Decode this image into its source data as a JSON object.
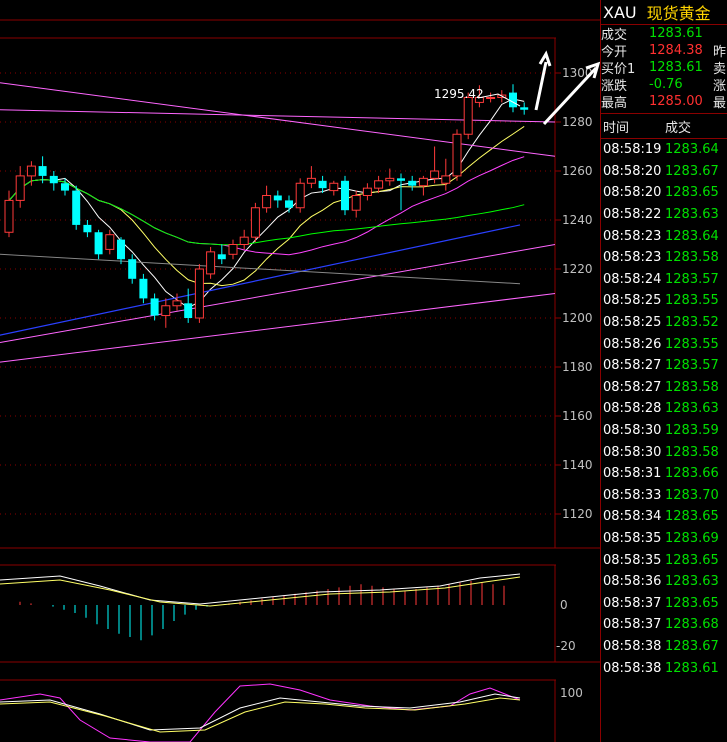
{
  "colors": {
    "up": "#ff3a3a",
    "down": "#00ffff",
    "grid": "#8a0000",
    "ma5": "#ffffff",
    "ma10": "#ffff66",
    "ma20": "#ff44ff",
    "ma60": "#00ff00",
    "trend_blue": "#2a40ff",
    "trend_pink": "#ff66ff"
  },
  "price_axis": {
    "ticks": [
      "1300",
      "1280",
      "1260",
      "1240",
      "1220",
      "1200",
      "1180",
      "1160",
      "1140",
      "1120"
    ]
  },
  "macd_axis": {
    "ticks": [
      "0",
      "-20"
    ]
  },
  "kdj_axis": {
    "ticks": [
      "100"
    ]
  },
  "annotation": {
    "high_label": "1295.42"
  },
  "chart_data": {
    "type": "candlestick",
    "ylim": [
      1110,
      1305
    ],
    "candles": [
      {
        "o": 1235,
        "c": 1248,
        "h": 1252,
        "l": 1233
      },
      {
        "o": 1248,
        "c": 1258,
        "h": 1262,
        "l": 1245
      },
      {
        "o": 1258,
        "c": 1262,
        "h": 1264,
        "l": 1254
      },
      {
        "o": 1262,
        "c": 1258,
        "h": 1266,
        "l": 1255
      },
      {
        "o": 1258,
        "c": 1255,
        "h": 1260,
        "l": 1252
      },
      {
        "o": 1255,
        "c": 1252,
        "h": 1257,
        "l": 1250
      },
      {
        "o": 1252,
        "c": 1238,
        "h": 1254,
        "l": 1236
      },
      {
        "o": 1238,
        "c": 1235,
        "h": 1240,
        "l": 1233
      },
      {
        "o": 1235,
        "c": 1226,
        "h": 1236,
        "l": 1224
      },
      {
        "o": 1228,
        "c": 1234,
        "h": 1236,
        "l": 1226
      },
      {
        "o": 1232,
        "c": 1224,
        "h": 1233,
        "l": 1222
      },
      {
        "o": 1224,
        "c": 1216,
        "h": 1226,
        "l": 1214
      },
      {
        "o": 1216,
        "c": 1208,
        "h": 1218,
        "l": 1206
      },
      {
        "o": 1208,
        "c": 1201,
        "h": 1210,
        "l": 1199
      },
      {
        "o": 1201,
        "c": 1205,
        "h": 1208,
        "l": 1196
      },
      {
        "o": 1205,
        "c": 1207,
        "h": 1210,
        "l": 1203
      },
      {
        "o": 1206,
        "c": 1200,
        "h": 1212,
        "l": 1198
      },
      {
        "o": 1200,
        "c": 1220,
        "h": 1222,
        "l": 1198
      },
      {
        "o": 1218,
        "c": 1227,
        "h": 1229,
        "l": 1216
      },
      {
        "o": 1226,
        "c": 1224,
        "h": 1230,
        "l": 1222
      },
      {
        "o": 1226,
        "c": 1230,
        "h": 1232,
        "l": 1224
      },
      {
        "o": 1230,
        "c": 1233,
        "h": 1236,
        "l": 1228
      },
      {
        "o": 1233,
        "c": 1245,
        "h": 1247,
        "l": 1231
      },
      {
        "o": 1245,
        "c": 1250,
        "h": 1254,
        "l": 1243
      },
      {
        "o": 1250,
        "c": 1248,
        "h": 1252,
        "l": 1245
      },
      {
        "o": 1248,
        "c": 1245,
        "h": 1250,
        "l": 1243
      },
      {
        "o": 1245,
        "c": 1255,
        "h": 1257,
        "l": 1243
      },
      {
        "o": 1255,
        "c": 1257,
        "h": 1262,
        "l": 1253
      },
      {
        "o": 1256,
        "c": 1253,
        "h": 1258,
        "l": 1251
      },
      {
        "o": 1252,
        "c": 1255,
        "h": 1256,
        "l": 1250
      },
      {
        "o": 1256,
        "c": 1244,
        "h": 1258,
        "l": 1242
      },
      {
        "o": 1244,
        "c": 1250,
        "h": 1252,
        "l": 1241
      },
      {
        "o": 1250,
        "c": 1253,
        "h": 1255,
        "l": 1248
      },
      {
        "o": 1253,
        "c": 1256,
        "h": 1258,
        "l": 1251
      },
      {
        "o": 1256,
        "c": 1257,
        "h": 1261,
        "l": 1254
      },
      {
        "o": 1257,
        "c": 1256,
        "h": 1259,
        "l": 1244
      },
      {
        "o": 1256,
        "c": 1254,
        "h": 1258,
        "l": 1252
      },
      {
        "o": 1254,
        "c": 1257,
        "h": 1258,
        "l": 1250
      },
      {
        "o": 1257,
        "c": 1260,
        "h": 1270,
        "l": 1255
      },
      {
        "o": 1255,
        "c": 1258,
        "h": 1265,
        "l": 1252
      },
      {
        "o": 1258,
        "c": 1275,
        "h": 1277,
        "l": 1256
      },
      {
        "o": 1275,
        "c": 1290,
        "h": 1292,
        "l": 1273
      },
      {
        "o": 1288,
        "c": 1290,
        "h": 1295,
        "l": 1286
      },
      {
        "o": 1290,
        "c": 1290,
        "h": 1292,
        "l": 1288
      },
      {
        "o": 1290,
        "c": 1291,
        "h": 1293,
        "l": 1288
      },
      {
        "o": 1292,
        "c": 1286,
        "h": 1295.42,
        "l": 1284
      },
      {
        "o": 1286,
        "c": 1285,
        "h": 1288,
        "l": 1283
      }
    ]
  },
  "quote": {
    "symbol": "XAU",
    "name": "现货黄金",
    "rows": [
      {
        "label": "成交",
        "value": "1283.61",
        "color": "#00e000",
        "side": ""
      },
      {
        "label": "今开",
        "value": "1284.38",
        "color": "#ff3030",
        "side": "昨"
      },
      {
        "label": "买价1",
        "value": "1283.61",
        "color": "#00e000",
        "side": "卖"
      },
      {
        "label": "涨跌",
        "value": "-0.76",
        "color": "#00e000",
        "side": "涨"
      },
      {
        "label": "最高",
        "value": "1285.00",
        "color": "#ff3030",
        "side": "最"
      }
    ]
  },
  "timesales": {
    "header_time": "时间",
    "header_price": "成交",
    "rows": [
      {
        "time": "08:58:19",
        "price": "1283.64"
      },
      {
        "time": "08:58:20",
        "price": "1283.67"
      },
      {
        "time": "08:58:20",
        "price": "1283.65"
      },
      {
        "time": "08:58:22",
        "price": "1283.63"
      },
      {
        "time": "08:58:23",
        "price": "1283.64"
      },
      {
        "time": "08:58:23",
        "price": "1283.58"
      },
      {
        "time": "08:58:24",
        "price": "1283.57"
      },
      {
        "time": "08:58:25",
        "price": "1283.55"
      },
      {
        "time": "08:58:25",
        "price": "1283.52"
      },
      {
        "time": "08:58:26",
        "price": "1283.55"
      },
      {
        "time": "08:58:27",
        "price": "1283.57"
      },
      {
        "time": "08:58:27",
        "price": "1283.58"
      },
      {
        "time": "08:58:28",
        "price": "1283.63"
      },
      {
        "time": "08:58:30",
        "price": "1283.59"
      },
      {
        "time": "08:58:30",
        "price": "1283.58"
      },
      {
        "time": "08:58:31",
        "price": "1283.66"
      },
      {
        "time": "08:58:33",
        "price": "1283.70"
      },
      {
        "time": "08:58:34",
        "price": "1283.65"
      },
      {
        "time": "08:58:35",
        "price": "1283.69"
      },
      {
        "time": "08:58:35",
        "price": "1283.65"
      },
      {
        "time": "08:58:36",
        "price": "1283.63"
      },
      {
        "time": "08:58:37",
        "price": "1283.65"
      },
      {
        "time": "08:58:37",
        "price": "1283.68"
      },
      {
        "time": "08:58:38",
        "price": "1283.67"
      },
      {
        "time": "08:58:38",
        "price": "1283.61"
      }
    ]
  }
}
